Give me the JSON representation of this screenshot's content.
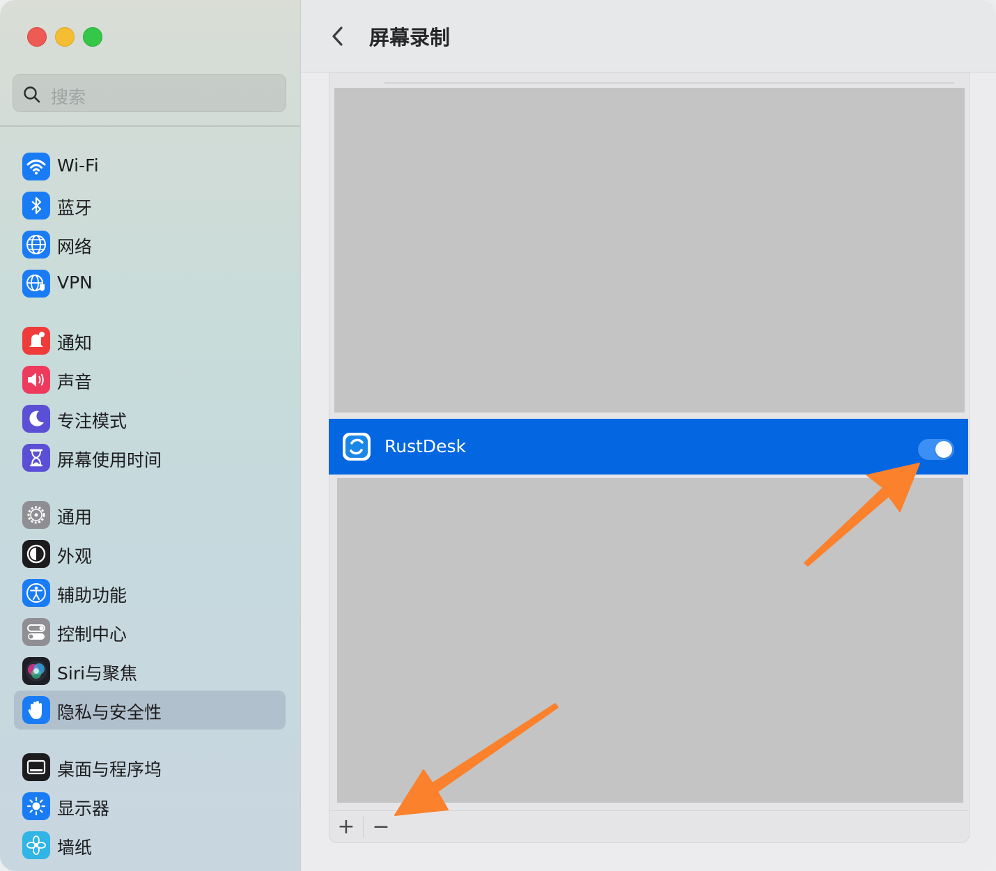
{
  "window": {
    "title": "屏幕录制"
  },
  "search": {
    "placeholder": "搜索"
  },
  "sidebar": {
    "items": [
      {
        "label": "Wi-Fi",
        "icon": "wifi-icon",
        "color": "#1a7cf5"
      },
      {
        "label": "蓝牙",
        "icon": "bluetooth-icon",
        "color": "#1a7cf5"
      },
      {
        "label": "网络",
        "icon": "globe-icon",
        "color": "#1a7cf5"
      },
      {
        "label": "VPN",
        "icon": "vpn-globe-icon",
        "color": "#1a7cf5"
      },
      {
        "label": "通知",
        "icon": "bell-icon",
        "color": "#ef3b3a"
      },
      {
        "label": "声音",
        "icon": "speaker-icon",
        "color": "#ee3a5c"
      },
      {
        "label": "专注模式",
        "icon": "moon-icon",
        "color": "#5b4fd6"
      },
      {
        "label": "屏幕使用时间",
        "icon": "hourglass-icon",
        "color": "#5b4fd6"
      },
      {
        "label": "通用",
        "icon": "gear-icon",
        "color": "#8e8e93"
      },
      {
        "label": "外观",
        "icon": "appearance-icon",
        "color": "#1c1c1e"
      },
      {
        "label": "辅助功能",
        "icon": "accessibility-icon",
        "color": "#1a7cf5"
      },
      {
        "label": "控制中心",
        "icon": "control-center-icon",
        "color": "#8e8e93"
      },
      {
        "label": "Siri与聚焦",
        "icon": "siri-icon",
        "color": "#2b2b36"
      },
      {
        "label": "隐私与安全性",
        "icon": "hand-icon",
        "color": "#1a7cf5",
        "selected": true
      },
      {
        "label": "桌面与程序坞",
        "icon": "dock-icon",
        "color": "#1c1c1e"
      },
      {
        "label": "显示器",
        "icon": "sun-icon",
        "color": "#1a7cf5"
      },
      {
        "label": "墙纸",
        "icon": "flower-icon",
        "color": "#31b4e6"
      }
    ]
  },
  "app_row": {
    "name": "RustDesk",
    "icon": "rustdesk-icon",
    "enabled": true
  },
  "footer": {
    "add": "+",
    "remove": "−"
  },
  "colors": {
    "selected_row": "#0466e0",
    "arrow": "#fb812c"
  }
}
